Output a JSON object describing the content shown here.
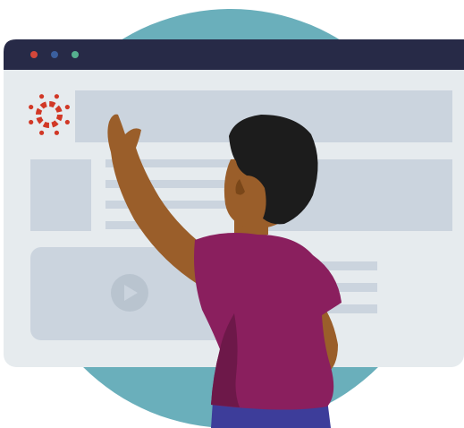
{
  "illustration": {
    "colors": {
      "backdrop_circle": "#6aafbb",
      "window_frame": "#e6ebee",
      "window_titlebar": "#272a47",
      "placeholder_block": "#cbd4de",
      "play_button_bg": "#b9c4cf",
      "play_glyph": "#cbd4de",
      "logo_red": "#d13826",
      "traffic_red": "#d4473a",
      "traffic_blue": "#3b5f9e",
      "traffic_green": "#56b08f",
      "skin": "#9a5e2a",
      "skin_shadow": "#7a4719",
      "hair": "#1c1c1c",
      "shirt": "#8a1f5e",
      "shirt_shadow": "#6d1849",
      "pants": "#3d3d9a"
    },
    "window": {
      "traffic_lights": [
        "red-dot",
        "blue-dot",
        "green-dot"
      ],
      "logo_icon": "canvas-logo-icon",
      "video_icon": "play-icon"
    }
  }
}
